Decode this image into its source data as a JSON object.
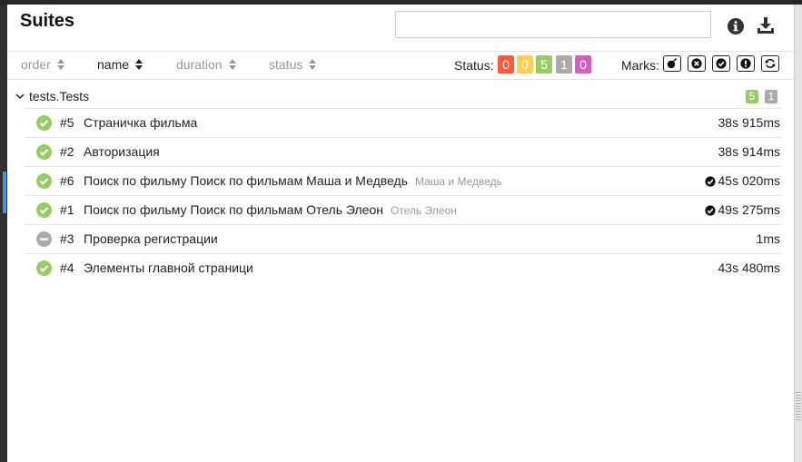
{
  "header": {
    "title": "Suites",
    "search_value": "",
    "search_placeholder": ""
  },
  "sorters": [
    {
      "label": "order",
      "active": false
    },
    {
      "label": "name",
      "active": true
    },
    {
      "label": "duration",
      "active": false
    },
    {
      "label": "status",
      "active": false
    }
  ],
  "status_filter": {
    "label": "Status:",
    "badges": [
      {
        "name": "failed",
        "count": "0",
        "color": "#fd5a3e"
      },
      {
        "name": "broken",
        "count": "0",
        "color": "#ffd050"
      },
      {
        "name": "passed",
        "count": "5",
        "color": "#97cc64"
      },
      {
        "name": "skipped",
        "count": "1",
        "color": "#aaaaaa"
      },
      {
        "name": "unknown",
        "count": "0",
        "color": "#d35ebe"
      }
    ]
  },
  "marks": {
    "label": "Marks:",
    "icons": [
      "bomb-icon",
      "close-circle-icon",
      "check-circle-icon",
      "exclamation-circle-icon",
      "refresh-icon"
    ]
  },
  "group": {
    "name": "tests.Tests",
    "counts": [
      {
        "value": "5",
        "color": "#97cc64"
      },
      {
        "value": "1",
        "color": "#aaaaaa"
      }
    ]
  },
  "tests": [
    {
      "num": "#5",
      "name": "Страничка фильма",
      "param": "",
      "status": "passed",
      "duration": "38s 915ms",
      "flagged": false
    },
    {
      "num": "#2",
      "name": "Авторизация",
      "param": "",
      "status": "passed",
      "duration": "38s 914ms",
      "flagged": false
    },
    {
      "num": "#6",
      "name": "Поиск по фильму Поиск по фильмам Маша и Медведь",
      "param": "Маша и Медведь",
      "status": "passed",
      "duration": "45s 020ms",
      "flagged": true
    },
    {
      "num": "#1",
      "name": "Поиск по фильму Поиск по фильмам Отель Элеон",
      "param": "Отель Элеон",
      "status": "passed",
      "duration": "49s 275ms",
      "flagged": true
    },
    {
      "num": "#3",
      "name": "Проверка регистрации",
      "param": "",
      "status": "skipped",
      "duration": "1ms",
      "flagged": false
    },
    {
      "num": "#4",
      "name": "Элементы главной страници",
      "param": "",
      "status": "passed",
      "duration": "43s 480ms",
      "flagged": false
    }
  ],
  "colors": {
    "passed": "#97cc64",
    "skipped": "#aaaaaa"
  }
}
